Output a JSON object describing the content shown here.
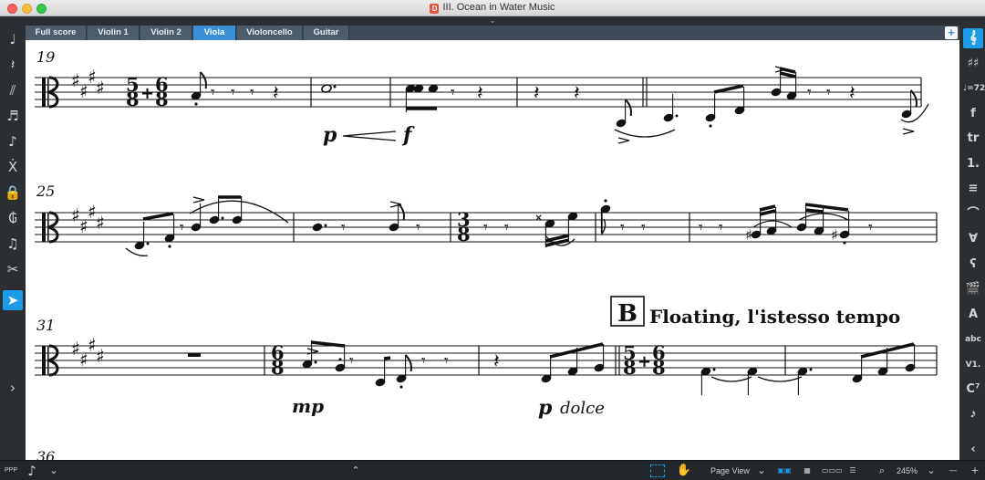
{
  "window": {
    "title": "III. Ocean in Water Music",
    "doc_icon_letter": "D"
  },
  "tabs": [
    {
      "label": "Full score",
      "active": false
    },
    {
      "label": "Violin 1",
      "active": false
    },
    {
      "label": "Violin 2",
      "active": false
    },
    {
      "label": "Viola",
      "active": true
    },
    {
      "label": "Violoncello",
      "active": false
    },
    {
      "label": "Guitar",
      "active": false
    }
  ],
  "tab_add_label": "+",
  "left_tools": [
    {
      "name": "note-input-icon",
      "glyph": "♩"
    },
    {
      "name": "rest-icon",
      "glyph": "𝄽"
    },
    {
      "name": "tremolo-icon",
      "glyph": "⫽"
    },
    {
      "name": "chord-icon",
      "glyph": "♬"
    },
    {
      "name": "grace-note-icon",
      "glyph": "♪"
    },
    {
      "name": "cross-staff-icon",
      "glyph": "Ẋ"
    },
    {
      "name": "lock-duration-icon",
      "glyph": "🔒"
    },
    {
      "name": "tie-icon",
      "glyph": "₲"
    },
    {
      "name": "tuplet-icon",
      "glyph": "♫"
    },
    {
      "name": "scissors-icon",
      "glyph": "✂"
    },
    {
      "name": "select-arrow-icon",
      "glyph": "➤"
    }
  ],
  "left_expand": "›",
  "right_tools": [
    {
      "name": "clef-icon",
      "glyph": "𝄞"
    },
    {
      "name": "key-signature-icon",
      "glyph": "♯♯"
    },
    {
      "name": "time-signature-icon",
      "glyph": "♩=72"
    },
    {
      "name": "dynamics-icon",
      "glyph": "f"
    },
    {
      "name": "ornaments-icon",
      "glyph": "tr"
    },
    {
      "name": "repeat-ending-icon",
      "glyph": "1."
    },
    {
      "name": "articulation-icon",
      "glyph": "≡"
    },
    {
      "name": "fermata-icon",
      "glyph": "⌒"
    },
    {
      "name": "bowing-icon",
      "glyph": "∀"
    },
    {
      "name": "playing-technique-icon",
      "glyph": "ʕ"
    },
    {
      "name": "tempo-icon",
      "glyph": "🎬"
    },
    {
      "name": "text-icon",
      "glyph": "A"
    },
    {
      "name": "lyrics-icon",
      "glyph": "abc"
    },
    {
      "name": "fingering-icon",
      "glyph": "V1."
    },
    {
      "name": "chord-symbol-icon",
      "glyph": "C⁷"
    },
    {
      "name": "notehead-icon",
      "glyph": "𝅘𝅥𝅯"
    },
    {
      "name": "collapse-panel-icon",
      "glyph": "‹"
    }
  ],
  "score": {
    "systems": [
      {
        "measure_number": "19",
        "dynamic_1": "p",
        "dynamic_2": "f"
      },
      {
        "measure_number": "25"
      },
      {
        "measure_number": "31",
        "rehearsal_mark": "B",
        "tempo_text": "Floating, l'istesso tempo",
        "dynamic_mp": "mp",
        "dynamic_p": "p",
        "expression": "dolce"
      },
      {
        "measure_number": "36"
      }
    ],
    "time_signatures": {
      "five_eight": [
        "5",
        "8"
      ],
      "plus": "+",
      "six_eight": [
        "6",
        "8"
      ],
      "three_eight": [
        "3",
        "8"
      ]
    }
  },
  "statusbar": {
    "ppp_label": "PPP",
    "note_glyph": "♪",
    "view_mode": "Page View",
    "zoom": "245%",
    "up_arrow": "⌃",
    "minus": "—",
    "plus": "+"
  },
  "colors": {
    "accent": "#1e9be6",
    "active_tab": "#3a8fd6",
    "tabbar": "#4c5c6b",
    "sidebar": "#2b2f33"
  }
}
